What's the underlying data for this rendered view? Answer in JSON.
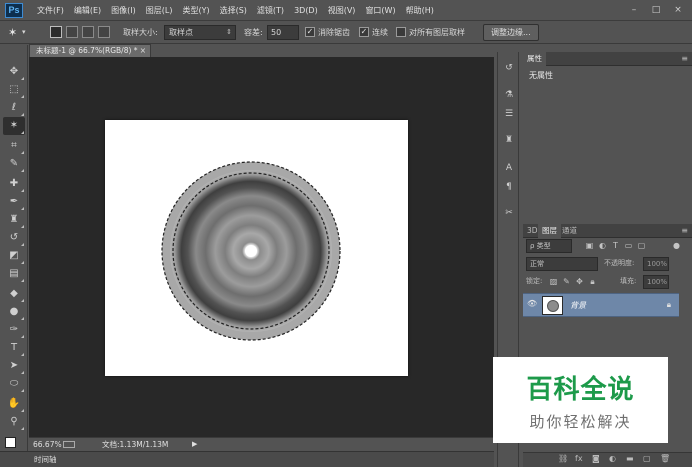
{
  "app": {
    "logo": "Ps"
  },
  "menu": [
    "文件(F)",
    "编辑(E)",
    "图像(I)",
    "图层(L)",
    "类型(Y)",
    "选择(S)",
    "滤镜(T)",
    "3D(D)",
    "视图(V)",
    "窗口(W)",
    "帮助(H)"
  ],
  "window_controls": {
    "minimize": "–",
    "restore": "□",
    "close": "×"
  },
  "options": {
    "sample_size_label": "取样大小:",
    "sample_size_value": "取样点",
    "tolerance_label": "容差:",
    "tolerance_value": "50",
    "antialias_label": "消除锯齿",
    "antialias_checked": true,
    "contiguous_label": "连续",
    "contiguous_checked": true,
    "sample_all_label": "对所有图层取样",
    "sample_all_checked": false,
    "refine_edge_button": "调整边缘..."
  },
  "document": {
    "tab_title": "未标题-1 @ 66.7%(RGB/8) *",
    "tab_close": "×",
    "zoom": "66.67%",
    "doc_info": "文档:1.13M/1.13M",
    "timeline_label": "时间轴",
    "canvas_bg": "#ffffff",
    "workspace_bg": "#282828"
  },
  "tools": [
    {
      "name": "move-tool",
      "glyph": "✥"
    },
    {
      "name": "marquee-tool",
      "glyph": "⬚"
    },
    {
      "name": "lasso-tool",
      "glyph": "ℓ"
    },
    {
      "name": "magic-wand-tool",
      "glyph": "✶"
    },
    {
      "name": "crop-tool",
      "glyph": "⌗"
    },
    {
      "name": "eyedropper-tool",
      "glyph": "✎"
    },
    {
      "name": "healing-brush-tool",
      "glyph": "✚"
    },
    {
      "name": "brush-tool",
      "glyph": "✒"
    },
    {
      "name": "clone-stamp-tool",
      "glyph": "♜"
    },
    {
      "name": "history-brush-tool",
      "glyph": "↺"
    },
    {
      "name": "eraser-tool",
      "glyph": "◩"
    },
    {
      "name": "gradient-tool",
      "glyph": "▤"
    },
    {
      "name": "blur-tool",
      "glyph": "◆"
    },
    {
      "name": "dodge-tool",
      "glyph": "●"
    },
    {
      "name": "pen-tool",
      "glyph": "✑"
    },
    {
      "name": "type-tool",
      "glyph": "T"
    },
    {
      "name": "path-selection-tool",
      "glyph": "➤"
    },
    {
      "name": "ellipse-tool",
      "glyph": "⬭"
    },
    {
      "name": "hand-tool",
      "glyph": "✋"
    },
    {
      "name": "zoom-tool",
      "glyph": "⚲"
    }
  ],
  "properties_panel": {
    "tab_label": "属性",
    "content": "无属性",
    "menu_glyph": "≡"
  },
  "layers_panel": {
    "tabs": [
      "3D",
      "图层",
      "通道"
    ],
    "filter_value": "ρ 类型",
    "blend_mode": "正常",
    "opacity_label": "不透明度:",
    "opacity_value": "100%",
    "lock_label": "锁定:",
    "fill_label": "填充:",
    "fill_value": "100%",
    "layer_name": "背景",
    "selected_row_color": "#6e87a8"
  },
  "watermark": {
    "title": "百科全说",
    "subtitle": "助你轻松解决",
    "title_color": "#1d9a4a"
  }
}
